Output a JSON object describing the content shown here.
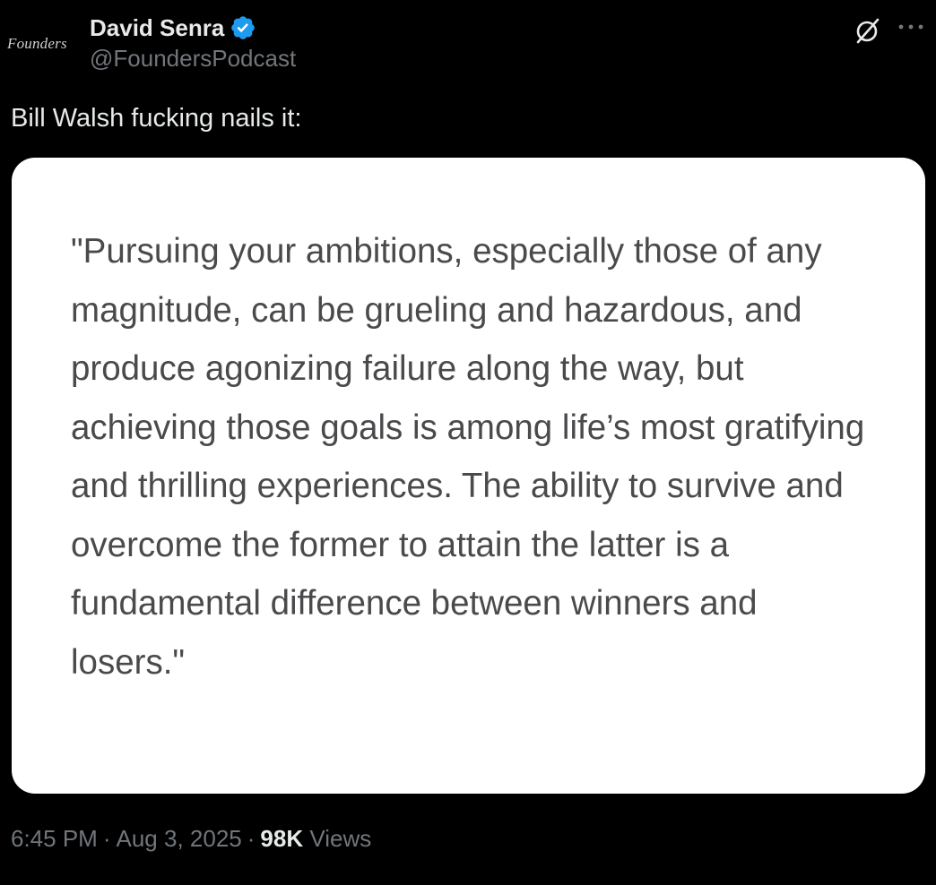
{
  "author": {
    "avatar_text": "Founders",
    "display_name": "David Senra",
    "handle": "@FoundersPodcast",
    "verified": true,
    "verified_color": "#1d9bf0"
  },
  "header_icons": {
    "grok": "grok-icon",
    "more": "more-icon"
  },
  "tweet": {
    "text": "Bill Walsh fucking nails it:",
    "media_quote": "\"Pursuing your ambitions, especially those of any magnitude, can be grueling and hazardous, and produce agonizing failure along the way, but achieving those goals is among life’s most gratifying and thrilling experiences. The ability to survive and overcome the former to attain the latter is a fundamental difference between winners and losers.\""
  },
  "meta": {
    "time": "6:45 PM",
    "separator": "·",
    "date": "Aug 3, 2025",
    "views_count": "98K",
    "views_label": "Views"
  },
  "colors": {
    "background": "#000000",
    "primary_text": "#e7e9ea",
    "secondary_text": "#71767b",
    "card_background": "#ffffff",
    "quote_text": "#4a4a4c"
  }
}
